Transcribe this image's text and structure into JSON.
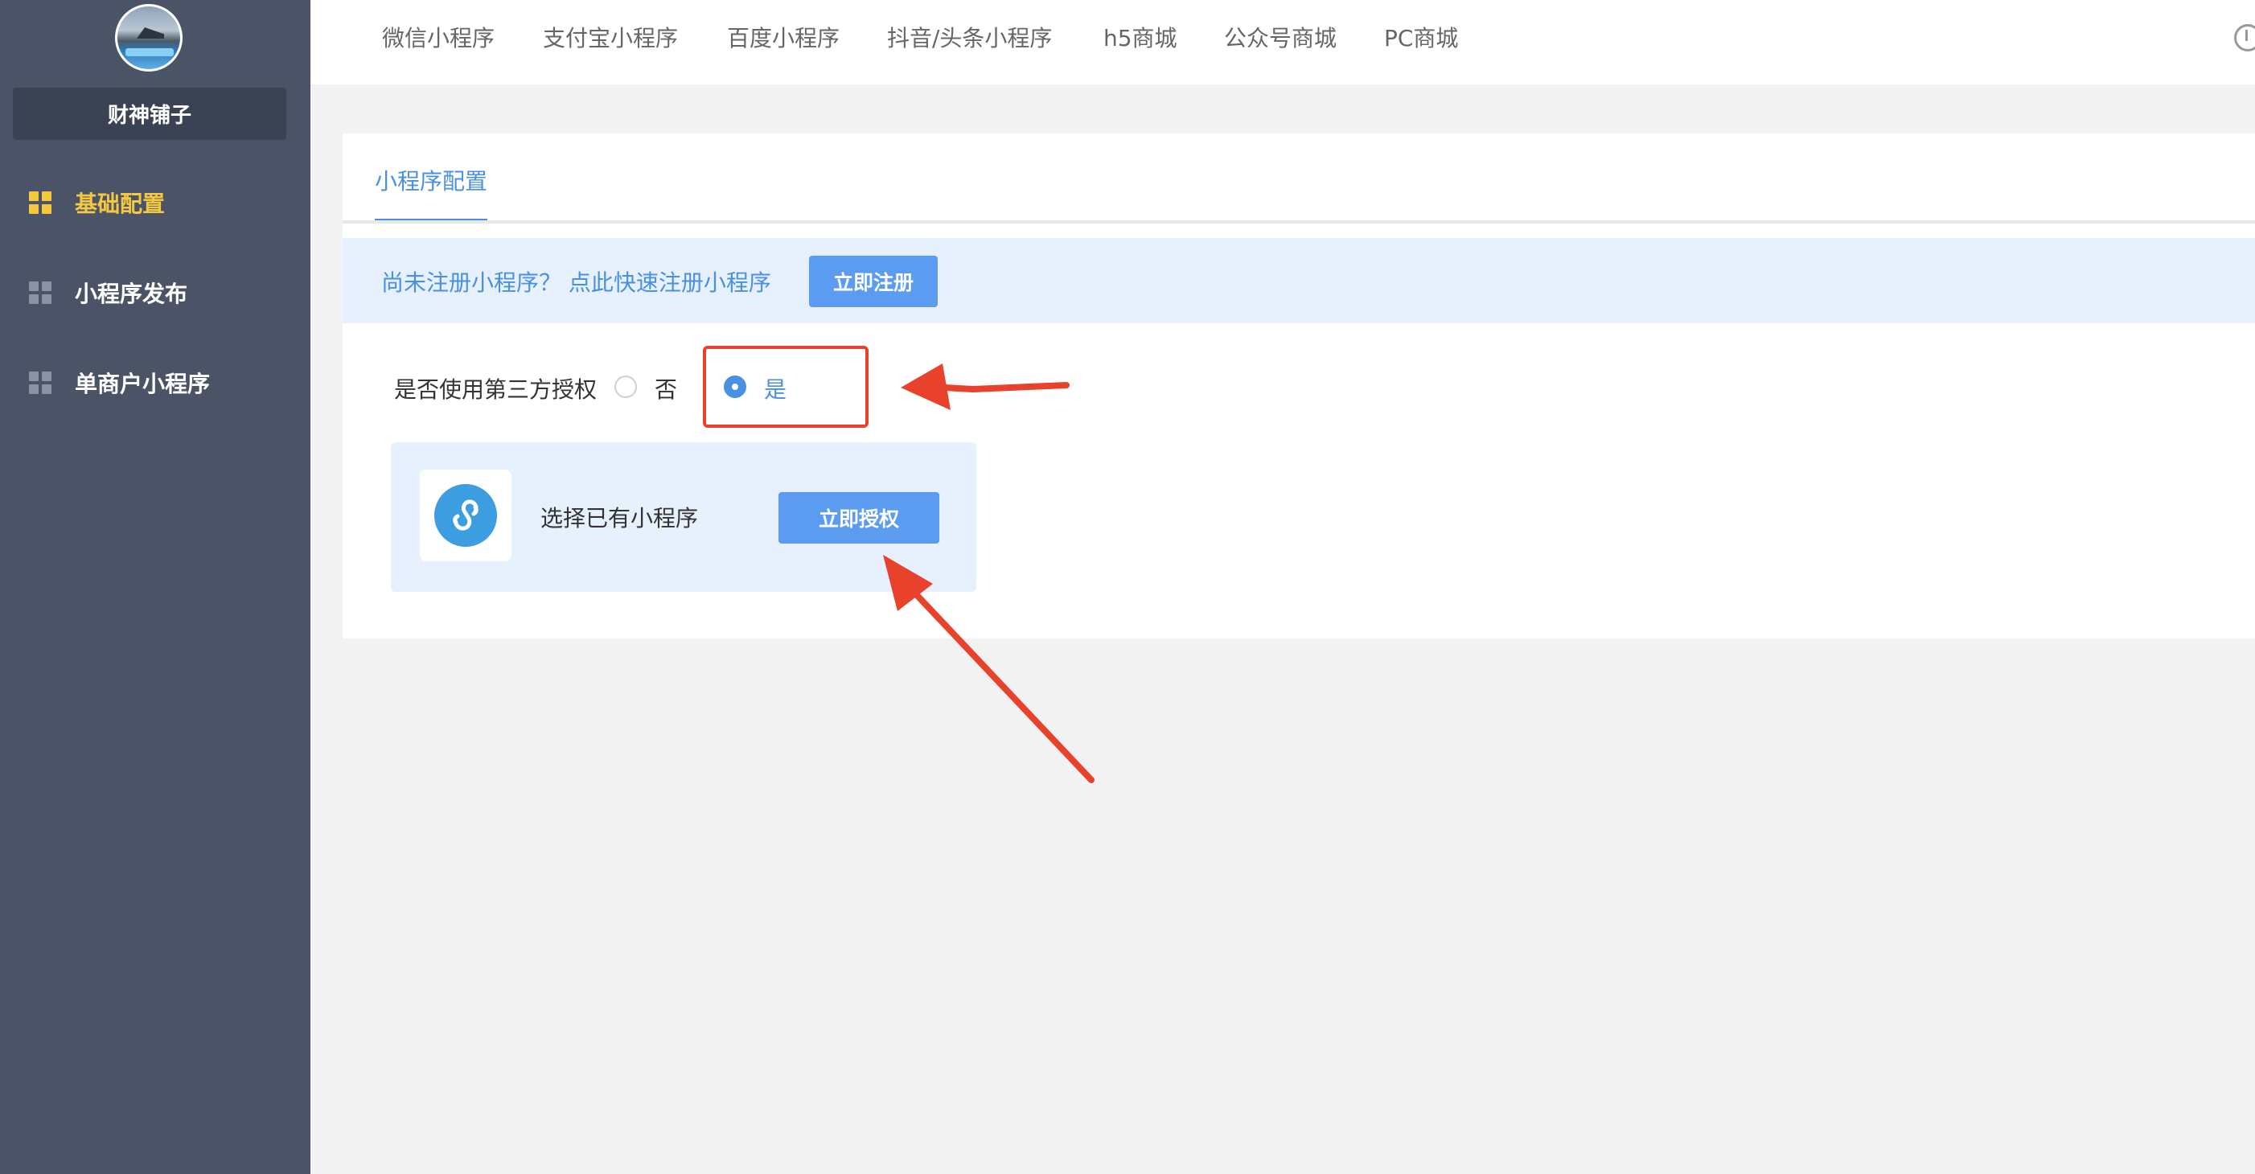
{
  "sidebar": {
    "shop_name": "财神铺子",
    "items": [
      {
        "label": "基础配置",
        "active": true,
        "icon": "grid-icon"
      },
      {
        "label": "小程序发布",
        "active": false,
        "icon": "grid-icon"
      },
      {
        "label": "单商户小程序",
        "active": false,
        "icon": "grid-icon"
      }
    ]
  },
  "topnav": {
    "tabs": [
      {
        "label": "微信小程序"
      },
      {
        "label": "支付宝小程序"
      },
      {
        "label": "百度小程序"
      },
      {
        "label": "抖音/头条小程序"
      },
      {
        "label": "h5商城"
      },
      {
        "label": "公众号商城"
      },
      {
        "label": "PC商城"
      }
    ],
    "right_icon": "download-icon"
  },
  "card": {
    "tab_label": "小程序配置",
    "notice_text": "尚未注册小程序？ 点此快速注册小程序",
    "register_button": "立即注册",
    "third_party_label": "是否使用第三方授权",
    "options": [
      {
        "label": "否",
        "selected": false
      },
      {
        "label": "是",
        "selected": true
      }
    ],
    "mini_program": {
      "text": "选择已有小程序",
      "authorize_button": "立即授权",
      "icon": "mini-program-logo-icon"
    }
  },
  "colors": {
    "sidebar_bg": "#4a5466",
    "active_yellow": "#f5c842",
    "primary_blue": "#4a90e2",
    "button_blue": "#5b9cf0",
    "annotation_red": "#e8412c"
  }
}
